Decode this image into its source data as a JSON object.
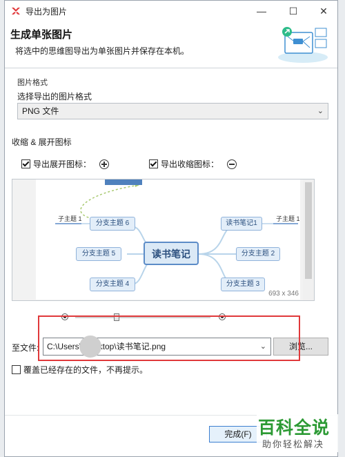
{
  "window": {
    "title": "导出为图片",
    "minimize": "—",
    "maximize": "☐",
    "close": "✕",
    "accent": "#e0383a"
  },
  "header": {
    "title": "生成单张图片",
    "subtitle": "将选中的思维图导出为单张图片并保存在本机。"
  },
  "format": {
    "group_label": "图片格式",
    "label": "选择导出的图片格式",
    "selected": "PNG 文件"
  },
  "collapse": {
    "label": "收缩 & 展开图标",
    "expand_label": "导出展开图标：",
    "expand_checked": true,
    "collapse_label": "导出收缩图标：",
    "collapse_checked": true
  },
  "preview": {
    "size_text": "693 x 346",
    "map": {
      "center": "读书笔记",
      "left_topics": [
        "分支主题 6",
        "分支主题 5",
        "分支主题 4"
      ],
      "right_topics": [
        "读书笔记1",
        "分支主题 2",
        "分支主题 3"
      ],
      "sub_left": "子主题 1",
      "sub_right": "子主题 1"
    }
  },
  "output": {
    "label": "至文件:",
    "path": "C:\\Users\\    Desktop\\读书笔记.png",
    "browse": "浏览...",
    "overwrite_label": "覆盖已经存在的文件，不再提示。",
    "overwrite_checked": false
  },
  "footer": {
    "finish": "完成(F)"
  },
  "watermark": {
    "main": "百科全说",
    "sub": "助你轻松解决"
  },
  "icons": [
    "xmind-logo-icon",
    "export-illustration-icon",
    "chevron-down-icon",
    "plus-circle-icon",
    "minus-circle-icon"
  ]
}
